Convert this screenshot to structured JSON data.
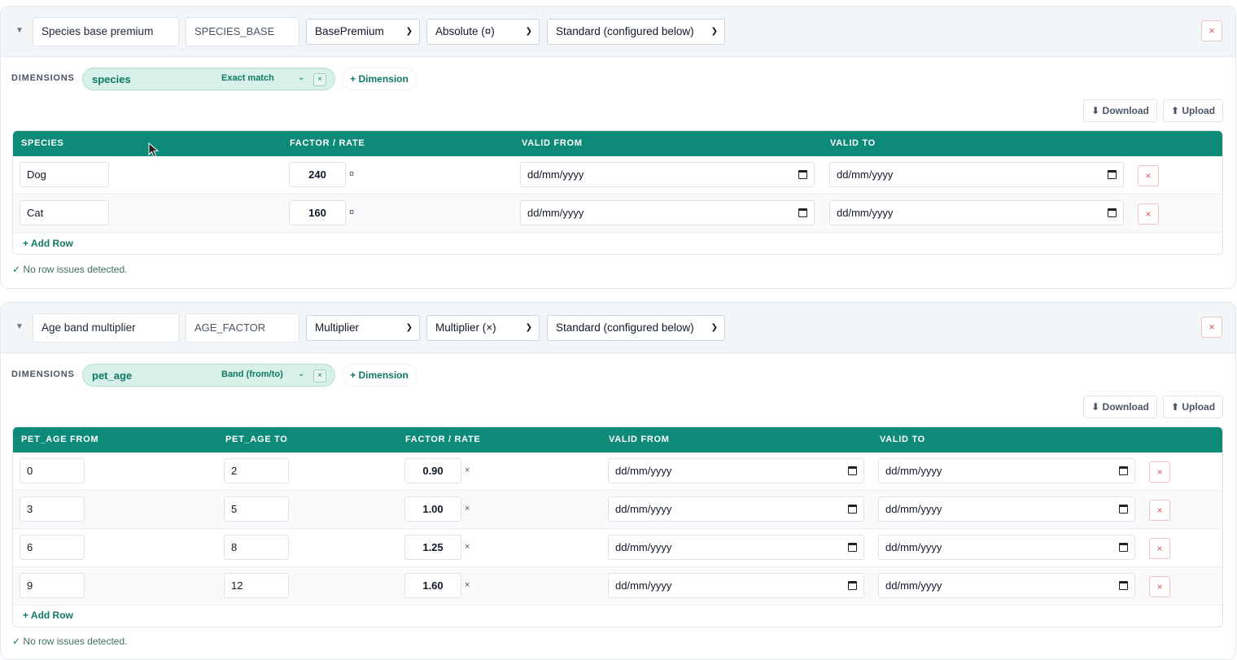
{
  "factors": [
    {
      "collapse_icon": "triangle-down-icon",
      "name": "Species base premium",
      "code": "SPECIES_BASE",
      "type": "BasePremium",
      "unit_mode": "Absolute (¤)",
      "config": "Standard (configured below)",
      "dimensions_label": "DIMENSIONS",
      "dimension": {
        "name": "species",
        "mode": "Exact match"
      },
      "add_dimension": "+ Dimension",
      "download": "⬇ Download",
      "upload": "⬆ Upload",
      "columns": [
        "SPECIES",
        "FACTOR / RATE",
        "VALID FROM",
        "VALID TO"
      ],
      "rows": [
        {
          "key": "Dog",
          "rate": "240",
          "unit": "¤",
          "valid_from": "dd/mm/yyyy",
          "valid_to": "dd/mm/yyyy"
        },
        {
          "key": "Cat",
          "rate": "160",
          "unit": "¤",
          "valid_from": "dd/mm/yyyy",
          "valid_to": "dd/mm/yyyy"
        }
      ],
      "add_row": "+ Add Row",
      "status_check": "✓",
      "status": "No row issues detected."
    },
    {
      "collapse_icon": "triangle-down-icon",
      "name": "Age band multiplier",
      "code": "AGE_FACTOR",
      "type": "Multiplier",
      "unit_mode": "Multiplier (×)",
      "config": "Standard (configured below)",
      "dimensions_label": "DIMENSIONS",
      "dimension": {
        "name": "pet_age",
        "mode": "Band (from/to)"
      },
      "add_dimension": "+ Dimension",
      "download": "⬇ Download",
      "upload": "⬆ Upload",
      "columns": [
        "PET_AGE FROM",
        "PET_AGE TO",
        "FACTOR / RATE",
        "VALID FROM",
        "VALID TO"
      ],
      "rows": [
        {
          "from": "0",
          "to": "2",
          "rate": "0.90",
          "unit": "×",
          "valid_from": "dd/mm/yyyy",
          "valid_to": "dd/mm/yyyy"
        },
        {
          "from": "3",
          "to": "5",
          "rate": "1.00",
          "unit": "×",
          "valid_from": "dd/mm/yyyy",
          "valid_to": "dd/mm/yyyy"
        },
        {
          "from": "6",
          "to": "8",
          "rate": "1.25",
          "unit": "×",
          "valid_from": "dd/mm/yyyy",
          "valid_to": "dd/mm/yyyy"
        },
        {
          "from": "9",
          "to": "12",
          "rate": "1.60",
          "unit": "×",
          "valid_from": "dd/mm/yyyy",
          "valid_to": "dd/mm/yyyy"
        }
      ],
      "add_row": "+ Add Row",
      "status_check": "✓",
      "status": "No row issues detected."
    }
  ],
  "icons": {
    "close": "×",
    "select_caret": "⌄"
  }
}
